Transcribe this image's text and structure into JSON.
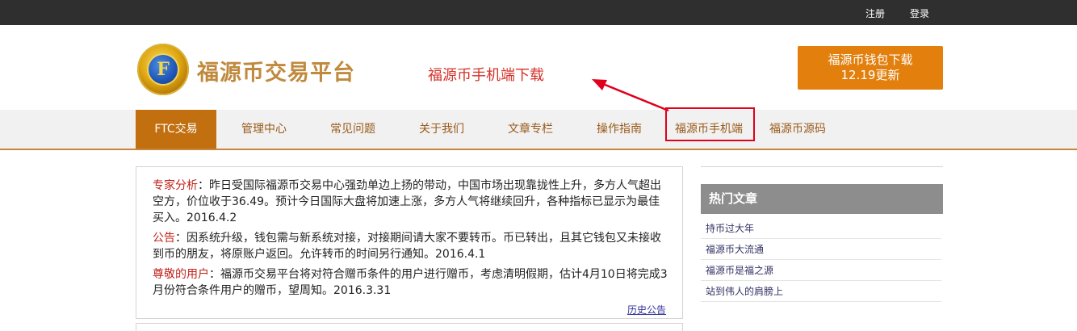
{
  "topbar": {
    "register": "注册",
    "login": "登录"
  },
  "brand": {
    "logo_letter": "F",
    "name": "福源币交易平台"
  },
  "header": {
    "mobile_download": "福源币手机端下载",
    "wallet_line1": "福源币钱包下载",
    "wallet_line2": "12.19更新"
  },
  "nav": [
    {
      "label": "FTC交易",
      "active": true
    },
    {
      "label": "管理中心"
    },
    {
      "label": "常见问题"
    },
    {
      "label": "关于我们"
    },
    {
      "label": "文章专栏"
    },
    {
      "label": "操作指南"
    },
    {
      "label": "福源币手机端"
    },
    {
      "label": "福源币源码"
    }
  ],
  "notices": [
    {
      "tag": "专家分析",
      "text": "：昨日受国际福源币交易中心强劲单边上扬的带动，中国市场出现靠拢性上升，多方人气超出空方，价位收于36.49。预计今日国际大盘将加速上涨，多方人气将继续回升，各种指标已显示为最佳买入。2016.4.2"
    },
    {
      "tag": "公告",
      "text": "：因系统升级，钱包需与新系统对接，对接期间请大家不要转币。币已转出，且其它钱包又未接收到币的朋友，将原账户返回。允许转币的时间另行通知。2016.4.1"
    },
    {
      "tag": "尊敬的用户",
      "text": "：福源币交易平台将对符合赠币条件的用户进行赠币，考虑清明假期，估计4月10日将完成3月份符合条件用户的赠币，望周知。2016.3.31"
    }
  ],
  "history_link": "历史公告",
  "hot_articles": {
    "title": "热门文章",
    "items": [
      "持币过大年",
      "福源币大流通",
      "福源币是福之源",
      "站到伟人的肩膀上"
    ]
  },
  "colors": {
    "accent": "#c26f10",
    "button": "#e27f0d",
    "annotation": "#e0001b"
  }
}
